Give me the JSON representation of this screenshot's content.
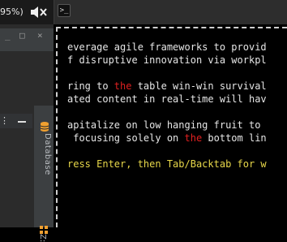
{
  "topbar": {
    "battery_text": "95%)",
    "terminal_tab_glyph": ">_"
  },
  "icons": {
    "volume": "speaker-muted-icon",
    "terminal": "terminal-icon",
    "database": "database-icon",
    "structure": "structure-icon"
  },
  "ide": {
    "minimize": "_",
    "restore": "□",
    "close": "×",
    "menu_dots": "⋮",
    "sidebar_database_label": "Database",
    "sidebar_structure_label": "Z:"
  },
  "terminal": {
    "line1": "everage agile frameworks to provid",
    "line2": "f disruptive innovation via workpl",
    "line3_pre": "ring to ",
    "line3_red": "the",
    "line3_post": " table win-win survival",
    "line4": "ated content in real-time will hav",
    "line5": "apitalize on low hanging fruit to ",
    "line6_pre": " focusing solely on ",
    "line6_red": "the",
    "line6_post": " bottom lin",
    "line7": "ress Enter, then Tab/Backtab for w"
  },
  "colors": {
    "highlight": "#e02020",
    "prompt": "#e8d84a"
  }
}
